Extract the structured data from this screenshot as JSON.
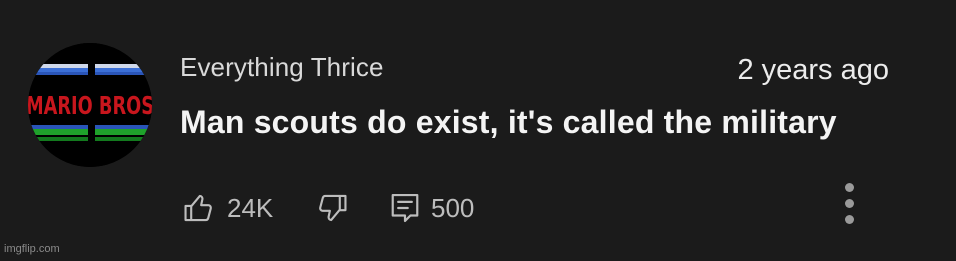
{
  "comment": {
    "author": "Everything Thrice",
    "timestamp": "2 years ago",
    "text": "Man scouts do exist, it's called the military",
    "avatar": {
      "icon": "channel-avatar-icon",
      "logo_text": "MARIO BROS"
    },
    "actions": {
      "like_icon": "thumbs-up-icon",
      "like_count": "24K",
      "dislike_icon": "thumbs-down-icon",
      "reply_icon": "comment-icon",
      "reply_count": "500",
      "more_icon": "vertical-dots-icon"
    }
  },
  "watermark": "imgflip.com",
  "colors": {
    "background": "#1b1b1b",
    "text_primary": "#f4f4f4",
    "text_secondary": "#bdbdbd",
    "logo_red": "#c8161d",
    "logo_blue": "#3b6fd6",
    "logo_green": "#1fa22b"
  }
}
